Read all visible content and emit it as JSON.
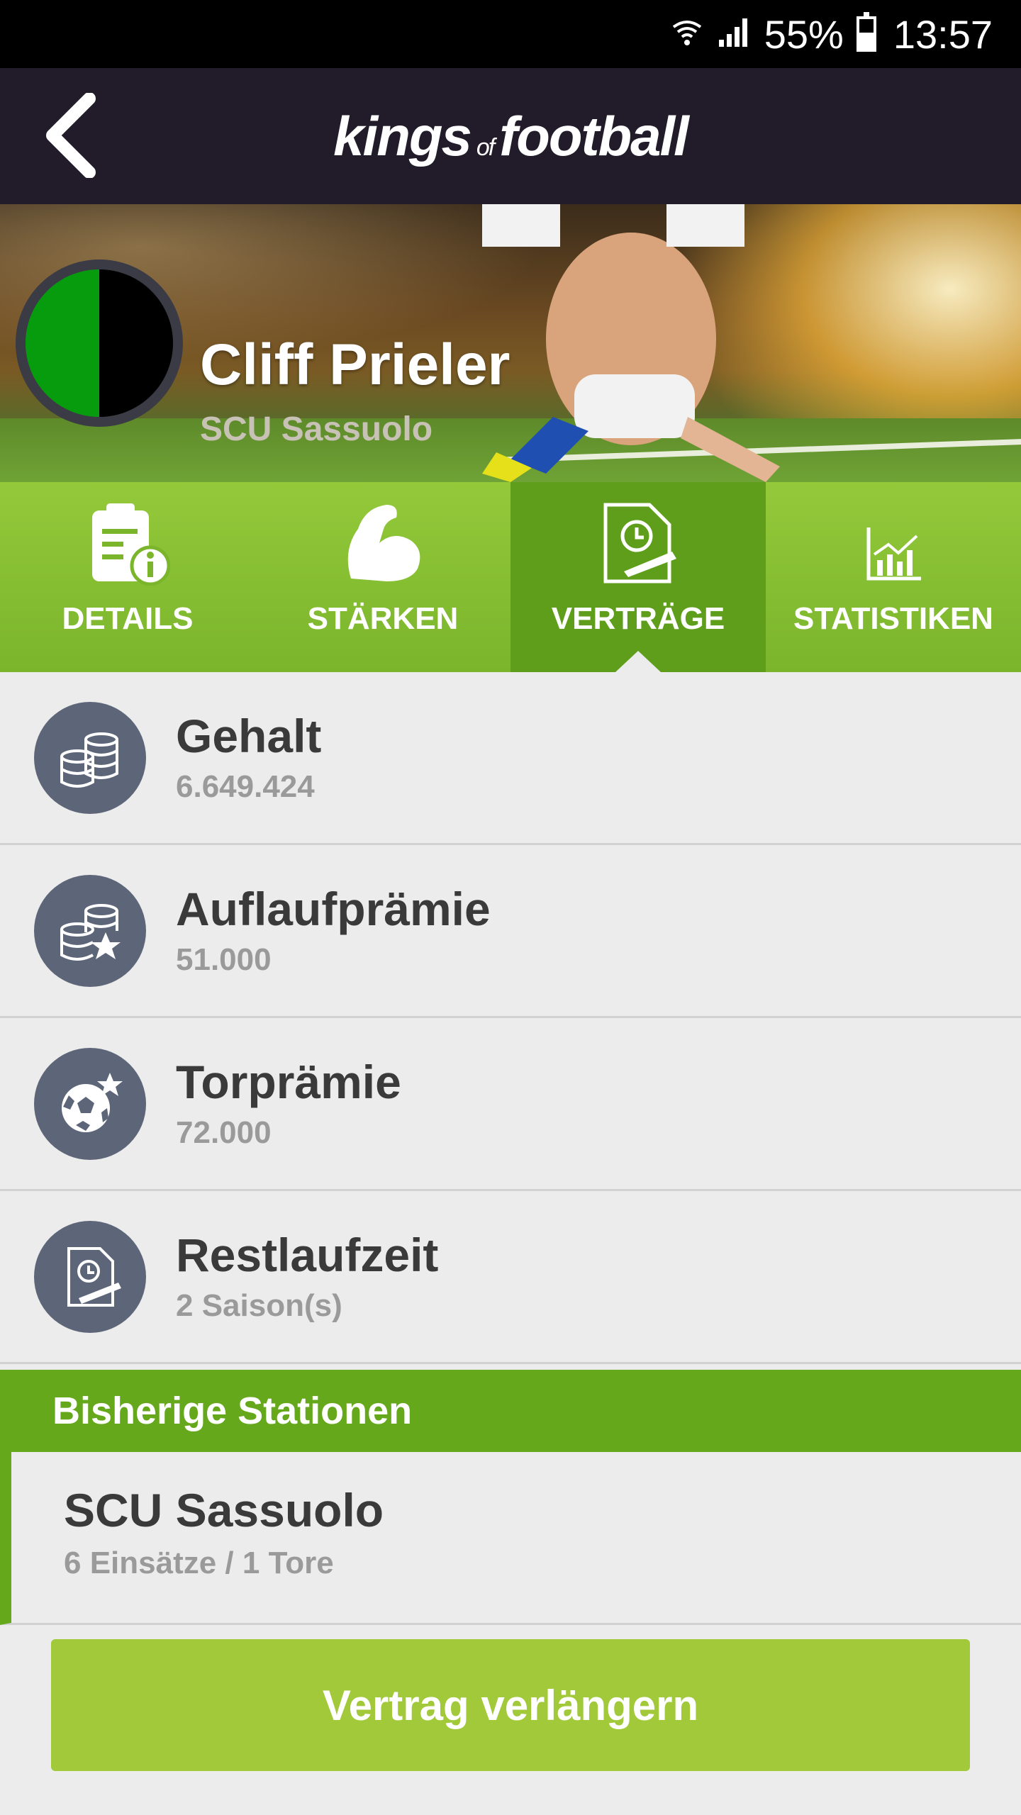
{
  "status_bar": {
    "battery": "55%",
    "time": "13:57",
    "icons": [
      "wifi-icon",
      "signal-icon",
      "battery-icon"
    ]
  },
  "header": {
    "logo_main": "kings",
    "logo_of": "of",
    "logo_end": "football",
    "back_icon": "chevron-left-icon"
  },
  "player": {
    "name": "Cliff Prieler",
    "club": "SCU Sassuolo",
    "badge_colors": [
      "#079c0d",
      "#000000"
    ]
  },
  "tabs": [
    {
      "label": "DETAILS",
      "icon": "clipboard-info-icon",
      "active": false
    },
    {
      "label": "STÄRKEN",
      "icon": "flexed-arm-icon",
      "active": false
    },
    {
      "label": "VERTRÄGE",
      "icon": "contract-icon",
      "active": true
    },
    {
      "label": "STATISTIKEN",
      "icon": "bar-chart-icon",
      "active": false
    }
  ],
  "contract": {
    "rows": [
      {
        "title": "Gehalt",
        "value": "6.649.424",
        "icon": "coins-icon"
      },
      {
        "title": "Auflaufprämie",
        "value": "51.000",
        "icon": "coins-star-icon"
      },
      {
        "title": "Torprämie",
        "value": "72.000",
        "icon": "football-star-icon"
      },
      {
        "title": "Restlaufzeit",
        "value": "2 Saison(s)",
        "icon": "contract-icon"
      }
    ]
  },
  "stations": {
    "header": "Bisherige Stationen",
    "items": [
      {
        "club": "SCU Sassuolo",
        "stats": "6 Einsätze / 1 Tore"
      }
    ]
  },
  "cta": {
    "label": "Vertrag verlängern"
  },
  "colors": {
    "appbar": "#221c2a",
    "tab_green": "#7ab52c",
    "tab_active": "#5f9e1b",
    "section_green": "#66a81c",
    "button_green": "#a1c93a",
    "icon_circle": "#5d6679"
  }
}
